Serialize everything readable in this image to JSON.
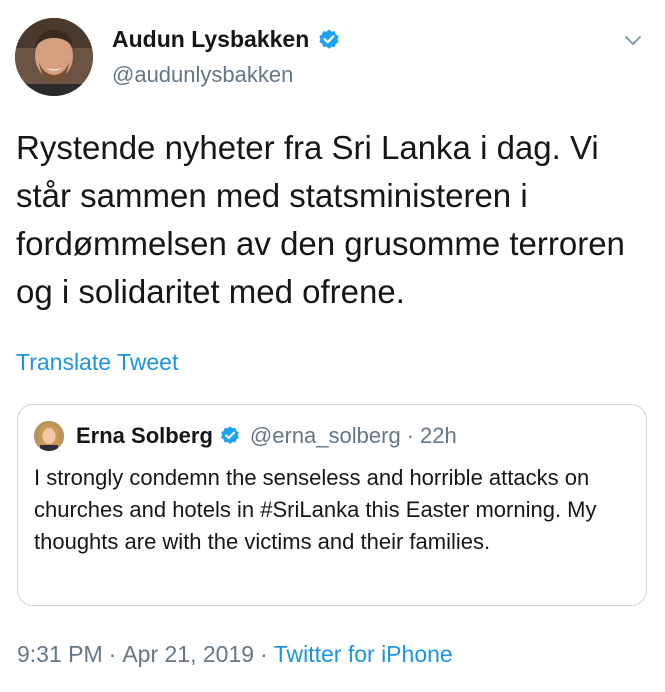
{
  "author": {
    "name": "Audun Lysbakken",
    "handle": "@audunlysbakken",
    "verified": true
  },
  "tweet": {
    "text": "Rystende nyheter fra Sri Lanka i dag. Vi står sammen med statsministeren i fordømmelsen av den grusomme terroren og i solidaritet med ofrene.",
    "translate_label": "Translate Tweet"
  },
  "quoted_tweet": {
    "name": "Erna Solberg",
    "handle": "@erna_solberg",
    "separator": "·",
    "time": "22h",
    "verified": true,
    "text": "I strongly condemn the senseless and horrible attacks on churches and hotels in #SriLanka this Easter morning. My thoughts are with the victims and their families."
  },
  "meta": {
    "time": "9:31 PM",
    "separator": "·",
    "date": "Apr 21, 2019",
    "source": "Twitter for iPhone"
  },
  "icons": {
    "verified": "verified-badge-icon",
    "caret": "chevron-down-icon"
  },
  "colors": {
    "link": "#1b95e0",
    "secondary_text": "#657786",
    "border": "#ccd6dd",
    "verified": "#1da1f2"
  }
}
